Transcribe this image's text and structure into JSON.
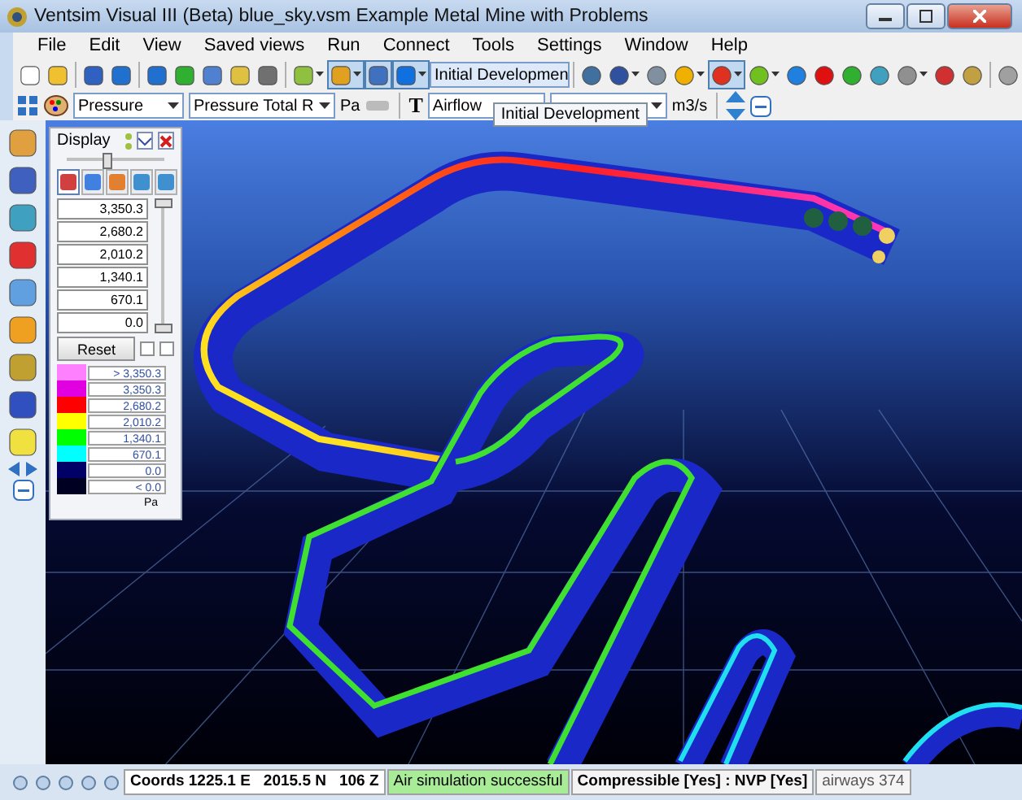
{
  "window": {
    "title": "Ventsim Visual III (Beta)   blue_sky.vsm   Example Metal Mine with Problems"
  },
  "menu": [
    "File",
    "Edit",
    "View",
    "Saved views",
    "Run",
    "Connect",
    "Tools",
    "Settings",
    "Window",
    "Help"
  ],
  "toolbar": {
    "buttons": [
      {
        "pressed": false
      },
      {
        "pressed": false
      },
      {
        "pressed": false
      },
      {
        "pressed": false
      },
      {
        "pressed": false
      },
      {
        "pressed": false
      },
      {
        "pressed": false
      },
      {
        "pressed": false
      },
      {
        "pressed": false
      },
      {
        "pressed": false
      },
      {
        "pressed": true
      },
      {
        "pressed": true
      },
      {
        "pressed": true
      }
    ],
    "view_dropdown": "Initial Developmen",
    "buttons_right": [
      {
        "pressed": false
      },
      {
        "pressed": false
      },
      {
        "pressed": false
      },
      {
        "pressed": false
      },
      {
        "pressed": true
      },
      {
        "pressed": false
      },
      {
        "pressed": false
      },
      {
        "pressed": false
      },
      {
        "pressed": false
      },
      {
        "pressed": false
      },
      {
        "pressed": false
      },
      {
        "pressed": false
      },
      {
        "pressed": false
      },
      {
        "pressed": false
      }
    ]
  },
  "toolbar2": {
    "color_dropdown": "Pressure",
    "color_sub_dropdown": "Pressure Total R",
    "color_unit": "Pa",
    "text_label": "T",
    "text_dropdown": "Airflow",
    "text_unit": "m3/s",
    "tooltip": "Initial Development"
  },
  "display": {
    "title": "Display",
    "opacity": {
      "level": 0.42
    },
    "tabs": [
      {
        "selected": true
      },
      {
        "selected": false
      },
      {
        "selected": false
      },
      {
        "selected": false
      },
      {
        "selected": false
      }
    ],
    "values": [
      "3,350.3",
      "2,680.2",
      "2,010.2",
      "1,340.1",
      "670.1",
      "0.0"
    ],
    "range_slider": [
      {
        "level": 1
      },
      {
        "level": 0
      }
    ],
    "reset": "Reset",
    "checkboxes": [
      {
        "checked": false
      },
      {
        "checked": false
      }
    ],
    "legend": [
      {
        "color": "#ff80ff",
        "label": "> 3,350.3"
      },
      {
        "color": "#e000e0",
        "label": "3,350.3"
      },
      {
        "color": "#ff0000",
        "label": "2,680.2"
      },
      {
        "color": "#ffff00",
        "label": "2,010.2"
      },
      {
        "color": "#00ff00",
        "label": "1,340.1"
      },
      {
        "color": "#00ffff",
        "label": "670.1"
      },
      {
        "color": "#000066",
        "label": "0.0"
      },
      {
        "color": "#000022",
        "label": "< 0.0"
      }
    ],
    "unit": "Pa"
  },
  "status_bar": {
    "coords": [
      "Coords 1225.1 E",
      "2015.5 N",
      "106 Z"
    ],
    "simulation": "Air simulation successful",
    "mode": "Compressible [Yes] : NVP [Yes]",
    "airways": "airways 374"
  }
}
